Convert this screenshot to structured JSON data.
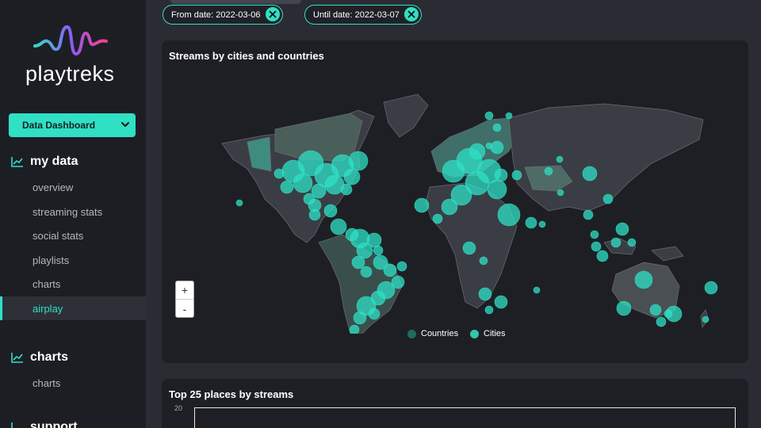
{
  "brand": {
    "name": "playtreks"
  },
  "sidebar": {
    "dashboard_select": "Data Dashboard",
    "section_my_data": "my data",
    "my_data_items": [
      "overview",
      "streaming stats",
      "social stats",
      "playlists",
      "charts",
      "airplay"
    ],
    "active_item": "airplay",
    "section_charts": "charts",
    "charts_items": [
      "charts"
    ],
    "section_support": "support"
  },
  "filters": {
    "from": "From date: 2022-03-06",
    "until": "Until date: 2022-03-07"
  },
  "map_card": {
    "title": "Streams by cities and countries",
    "zoom_in": "+",
    "zoom_out": "-",
    "legend": [
      {
        "label": "Countries",
        "color": "#1e6b5f"
      },
      {
        "label": "Cities",
        "color": "#2fc7ae"
      }
    ]
  },
  "top_places": {
    "title": "Top 25 places by streams",
    "y_tick": "20"
  },
  "colors": {
    "accent": "#2fe0c5",
    "sidebar_bg": "#1d1e24",
    "card_bg": "#1e1f25"
  }
}
